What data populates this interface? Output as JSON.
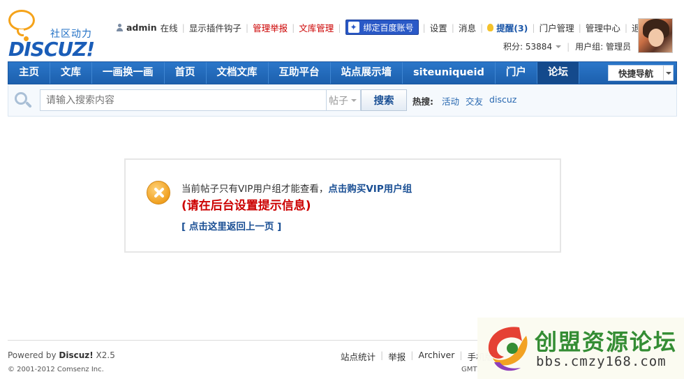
{
  "logo": {
    "tagline": "社区动力",
    "wordmark": "DISCUZ!"
  },
  "userbar": {
    "username": "admin",
    "online": "在线",
    "links": [
      "显示插件钩子",
      "管理举报",
      "文库管理"
    ],
    "baidu_button": "绑定百度账号",
    "settings": "设置",
    "messages": "消息",
    "remind": "提醒(3)",
    "portal_manage": "门户管理",
    "admin_center": "管理中心",
    "logout": "退出"
  },
  "credits": {
    "points": "积分: 53884",
    "usergroup": "用户组: 管理员"
  },
  "nav": {
    "items": [
      "主页",
      "文库",
      "一画换一画",
      "首页",
      "文档文库",
      "互助平台",
      "站点展示墙",
      "siteuniqueid",
      "门户",
      "论坛"
    ],
    "quicknav": "快捷导航"
  },
  "search": {
    "placeholder": "请输入搜索内容",
    "type": "帖子",
    "button": "搜索",
    "hot_label": "热搜:",
    "hot_keywords": [
      "活动",
      "交友",
      "discuz"
    ]
  },
  "message": {
    "line1_prefix": "当前帖子只有VIP用户组才能查看，",
    "line1_link": "点击购买VIP用户组",
    "line2": "(请在后台设置提示信息)",
    "back_link": "[ 点击这里返回上一页 ]"
  },
  "footer": {
    "powered_prefix": "Powered by ",
    "powered_brand": "Discuz!",
    "powered_version": " X2.5",
    "copyright": "© 2001-2012 Comsenz Inc.",
    "links": [
      "站点统计",
      "举报",
      "Archiver",
      "手机版"
    ],
    "gmt": "GMT,"
  },
  "watermark": {
    "title": "创盟资源论坛",
    "url": "bbs.cmzy168.com"
  },
  "colors": {
    "nav_bg": "#1c5fad",
    "link_blue": "#1a4f94",
    "alert_red": "#cc0000",
    "warning_orange": "#f0a020"
  }
}
